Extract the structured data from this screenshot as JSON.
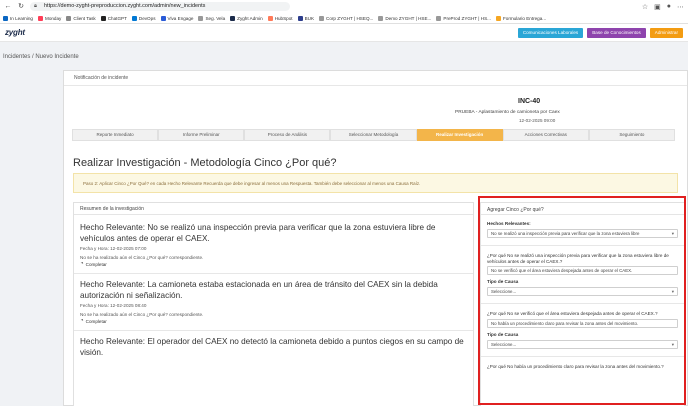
{
  "browser": {
    "url": "https://demo-zyght-preproduccion.zyght.com/admin/new_incidents",
    "bookmarks": [
      "In Learning",
      "Monday",
      "Client Task",
      "ChatGPT",
      "DevOps",
      "Viva Engage",
      "Seg. Vela",
      "Zyght Admin",
      "HubSpot",
      "BUK",
      "Corp ZYGHT | HSEQ...",
      "Demo ZYGHT | HSE...",
      "PreProd ZYGHT | HS...",
      "Formulario Entrega..."
    ]
  },
  "header": {
    "logo": "zyght",
    "buttons": [
      {
        "label": "Comunicaciones Laborales",
        "color": "#2aa6d6"
      },
      {
        "label": "Base de Conocimientos",
        "color": "#8e44ad"
      },
      {
        "label": "Administrar",
        "color": "#f39c12"
      }
    ]
  },
  "breadcrumb": "Incidentes / Nuevo Incidente",
  "card": {
    "title": "Notificación de incidente",
    "incident_id": "INC-40",
    "description": "PRUEBA - Aplastamiento de camioneta por Caex",
    "date": "12-02-2025 09:00",
    "steps": [
      "Reporte Inmediato",
      "Informe Preliminar",
      "Proceso de Análisis",
      "Seleccionar Metodología",
      "Realizar Investigación",
      "Acciones Correctivas",
      "Seguimiento"
    ],
    "active_step_index": 4,
    "section_title": "Realizar Investigación - Metodología Cinco ¿Por qué?",
    "alert_text": "Paso 2: Aplicar Cinco ¿Por Qué? en cada Hecho Relevante Recuerda que debe ingresar al menos una Respuesta. También debe seleccionar al menos una Causa Raíz."
  },
  "summary": {
    "header": "Resumen de la investigación",
    "items": [
      {
        "title": "Hecho Relevante: No se realizó una inspección previa para verificar que la zona estuviera libre de vehículos antes de operar el CAEX.",
        "meta": "Fecha y Hora: 12-02-2025 07:00",
        "warn": "No se ha realizado aún el Cinco ¿Por qué? correspondiente.",
        "done": "Completar"
      },
      {
        "title": "Hecho Relevante: La camioneta estaba estacionada en un área de tránsito del CAEX sin la debida autorización ni señalización.",
        "meta": "Fecha y Hora: 12-02-2025 08:40",
        "warn": "No se ha realizado aún el Cinco ¿Por qué? correspondiente.",
        "done": "Completar"
      },
      {
        "title": "Hecho Relevante: El operador del CAEX no detectó la camioneta debido a puntos ciegos en su campo de visión."
      }
    ]
  },
  "form": {
    "header": "Agregar Cinco ¿Por qué?",
    "hechos_label": "Hechos Relevantes:",
    "hechos_value": "No se realizó una inspección previa para verificar que la zona estuviera libre",
    "q1": "¿Por qué No se realizó una inspección previa para verificar que la zona estuviera libre de vehículos antes de operar el CAEX.?",
    "a1": "No se verificó que el área estuviera despejada antes de operar el CAEX.",
    "cause_label": "Tipo de Causa",
    "cause_placeholder": "Seleccione...",
    "q2": "¿Por qué No se verificó que el área estuviera despejada antes de operar el CAEX.?",
    "a2": "No había un procedimiento claro para revisar la zona antes del movimiento.",
    "q3": "¿Por qué No había un procedimiento claro para revisar la zona antes del movimiento.?"
  }
}
